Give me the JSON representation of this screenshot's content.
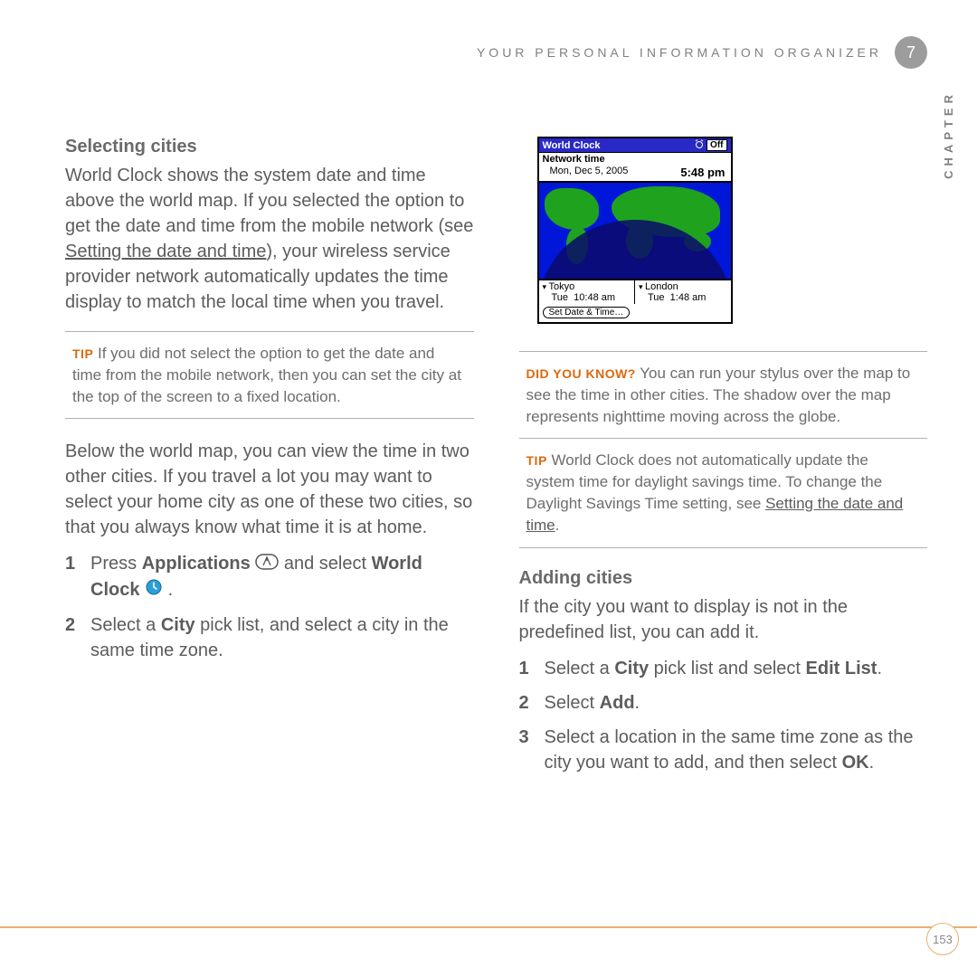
{
  "header": {
    "section_title": "YOUR PERSONAL INFORMATION ORGANIZER",
    "chapter_number": "7",
    "side_label": "CHAPTER"
  },
  "left": {
    "heading1": "Selecting cities",
    "para1a": "World Clock shows the system date and time above the world map. If you selected the option to get the date and time from the mobile network (see ",
    "para1_link": "Setting the date and time",
    "para1b": "), your wireless service provider network automatically updates the time display to match the local time when you travel.",
    "tip_label": "TIP",
    "tip_text": " If you did not select the option to get the date and time from the mobile network, then you can set the city at the top of the screen to a fixed location.",
    "para2": "Below the world map, you can view the time in two other cities. If you travel a lot you may want to select your home city as one of these two cities, so that you always know what time it is at home.",
    "step1a": "Press ",
    "step1b": "Applications",
    "step1c": " and select ",
    "step1d": "World Clock",
    "step1e": " .",
    "step2a": "Select a ",
    "step2b": "City",
    "step2c": " pick list, and select a city in the same time zone."
  },
  "right": {
    "dyk_label": "DID YOU KNOW?",
    "dyk_text": " You can run your stylus over the map to see the time in other cities. The shadow over the map represents nighttime moving across the globe.",
    "tip2_label": "TIP",
    "tip2a": " World Clock does not automatically update the system time for daylight savings time. To change the Daylight Savings Time setting, see ",
    "tip2_link": "Setting the date and time",
    "tip2b": ".",
    "heading2": "Adding cities",
    "para3": "If the city you want to display is not in the predefined list, you can add it.",
    "astep1a": "Select a ",
    "astep1b": "City",
    "astep1c": " pick list and select ",
    "astep1d": "Edit List",
    "astep1e": ".",
    "astep2a": "Select ",
    "astep2b": "Add",
    "astep2c": ".",
    "astep3a": "Select a location in the same time zone as the city you want to add, and then select ",
    "astep3b": "OK",
    "astep3c": "."
  },
  "device": {
    "title": "World Clock",
    "off": "Off",
    "network": "Network time",
    "date": "Mon, Dec 5, 2005",
    "time": "5:48 pm",
    "city1": "Tokyo",
    "city1_day": "Tue",
    "city1_time": "10:48 am",
    "city2": "London",
    "city2_day": "Tue",
    "city2_time": "1:48 am",
    "set_btn": "Set Date & Time…"
  },
  "page_number": "153"
}
